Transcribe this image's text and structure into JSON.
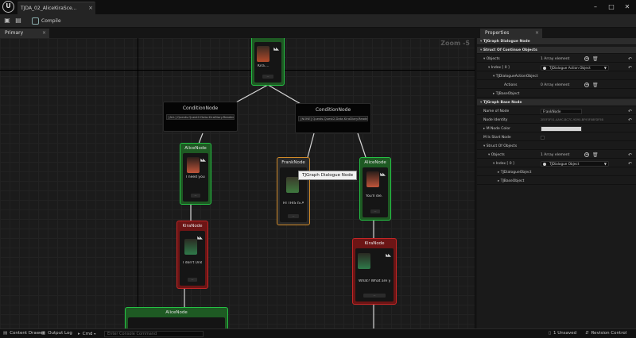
{
  "window": {
    "tab_title": "TJDA_02_AliceKiraSce...",
    "tab_close": "×",
    "controls": {
      "minimize": "–",
      "maximize": "□",
      "close": "✕"
    }
  },
  "toolbar": {
    "compile_label": "Compile"
  },
  "panels": {
    "graph_tab": "Primary",
    "graph_tab_close": "×",
    "properties_tab": "Properties",
    "properties_tab_close": "×"
  },
  "graph": {
    "zoom": "Zoom -5",
    "tooltip": "TJGraph Dialogue Node",
    "nodes": [
      {
        "key": "top",
        "title": "",
        "text": "Kira....",
        "variant": "green"
      },
      {
        "key": "cond_left",
        "title": "ConditionNode",
        "field": "[ALL] Quests.Quest2.Data.KiraDiary.Readed ( )"
      },
      {
        "key": "cond_right",
        "title": "ConditionNode",
        "field": "[NONE] Quests.Quest2.Data.KiraDiary.Readed ( )"
      },
      {
        "key": "alice1",
        "title": "AliceNode",
        "text": "I need you.",
        "variant": "green"
      },
      {
        "key": "frank",
        "title": "FrankNode",
        "text": "HI THIS IS A TEXT",
        "variant": "orange"
      },
      {
        "key": "alice2",
        "title": "AliceNode",
        "text": "You'll die.",
        "variant": "green"
      },
      {
        "key": "kira1",
        "title": "KiraNode",
        "text": "I don't Unders...",
        "variant": "red"
      },
      {
        "key": "kira2",
        "title": "KiraNode",
        "text": "What? What are you saying?",
        "variant": "red"
      },
      {
        "key": "alice3",
        "title": "AliceNode",
        "text": "",
        "variant": "green"
      }
    ]
  },
  "properties": {
    "rows": [
      {
        "label": "TJGraph Dialogue Node",
        "type": "section"
      },
      {
        "label": "Struct Of Continue Objects",
        "type": "section"
      },
      {
        "label": "Objects",
        "value": "1 Array element",
        "type": "array"
      },
      {
        "label": "Index [ 0 ]",
        "value": "TJDialogue Action Object",
        "type": "combo"
      },
      {
        "label": "TJDialogueActionObject",
        "type": "sub"
      },
      {
        "label": "Actions",
        "value": "0 Array element",
        "type": "array"
      },
      {
        "label": "TJBaseObject",
        "type": "sub"
      },
      {
        "label": "TJGraph Base Node",
        "type": "section"
      },
      {
        "label": "Name of Node",
        "value": "FrankNode",
        "type": "text"
      },
      {
        "label": "Node Identity",
        "value": "2EEF3F51-4A9C-BC7C-9D90-BF93F08FDF5B",
        "type": "plain"
      },
      {
        "label": "M Node Color",
        "type": "color"
      },
      {
        "label": "M Is Start Node",
        "type": "check"
      },
      {
        "label": "Struct Of Objects",
        "type": "section"
      },
      {
        "label": "Objects",
        "value": "1 Array element",
        "type": "array"
      },
      {
        "label": "Index [ 0 ]",
        "value": "TJDialogue Object",
        "type": "combo"
      },
      {
        "label": "TJDialogueObject",
        "type": "sub"
      },
      {
        "label": "TJBaseObject",
        "type": "sub"
      }
    ]
  },
  "statusbar": {
    "content_drawer": "Content Drawer",
    "output_log": "Output Log",
    "cmd": "Cmd",
    "cmd_placeholder": "Enter Console Command",
    "unsaved": "1 Unsaved",
    "revision": "Revision Control"
  },
  "colors": {
    "green_node": "#25c044",
    "red_node": "#c42626",
    "orange_node": "#d08a28",
    "background": "#1b1b1b"
  }
}
